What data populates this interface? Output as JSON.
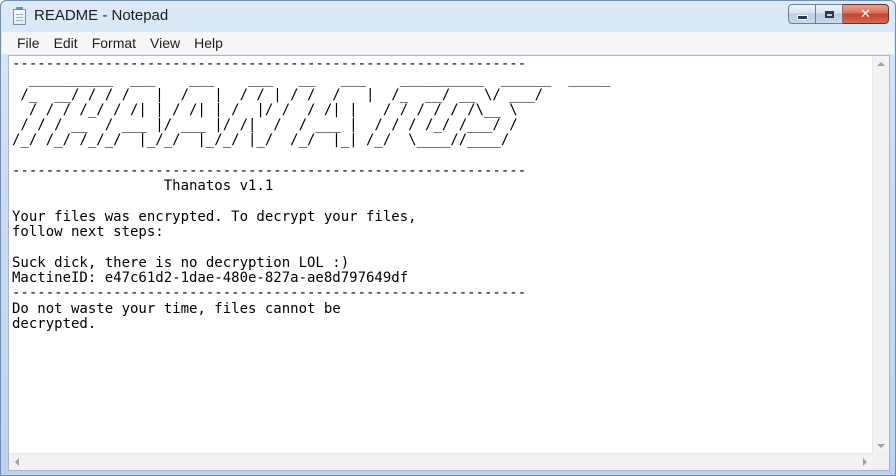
{
  "window": {
    "title": "README - Notepad",
    "icon": "notepad-icon",
    "controls": {
      "minimize_icon": "minimize-icon",
      "maximize_icon": "maximize-icon",
      "close_icon": "close-icon",
      "close_symbol": "✕"
    }
  },
  "menubar": {
    "items": [
      "File",
      "Edit",
      "Format",
      "View",
      "Help"
    ]
  },
  "document": {
    "lines": [
      "-------------------------------------------------------------",
      "  __________  ___    ___    ___   __   ___    __________  ______  _____ ",
      " /_  __/ / / /   |  /   |  / / | / /  /   |  /_  __/ __ \\/ ___/ ",
      "  / / / /_/ / /| | / /| | /  |/ /  / /| |   / / / / / /\\__ \\  ",
      " / / / __  / ___ |/ ___ |/ /|  /  / ___ |  / / / /_/ /___/ /  ",
      "/_/ /_/ /_/_/  |_/_/  |_/_/ |_/  /_/  |_| /_/  \\____//____/   ",
      "",
      "-------------------------------------------------------------",
      "                  Thanatos v1.1",
      "",
      "Your files was encrypted. To decrypt your files,",
      "follow next steps:",
      "",
      "Suck dick, there is no decryption LOL :)",
      "MactineID: e47c61d2-1dae-480e-827a-ae8d797649df",
      "-------------------------------------------------------------",
      "Do not waste your time, files cannot be",
      "decrypted."
    ]
  },
  "scrollbars": {
    "up_icon": "scroll-up-arrow-icon",
    "down_icon": "scroll-down-arrow-icon",
    "left_icon": "scroll-left-arrow-icon",
    "right_icon": "scroll-right-arrow-icon"
  },
  "colors": {
    "titlebar": "#c9dcf2",
    "close_button": "#c2412b",
    "editor_background": "#ffffff",
    "text": "#000000"
  }
}
